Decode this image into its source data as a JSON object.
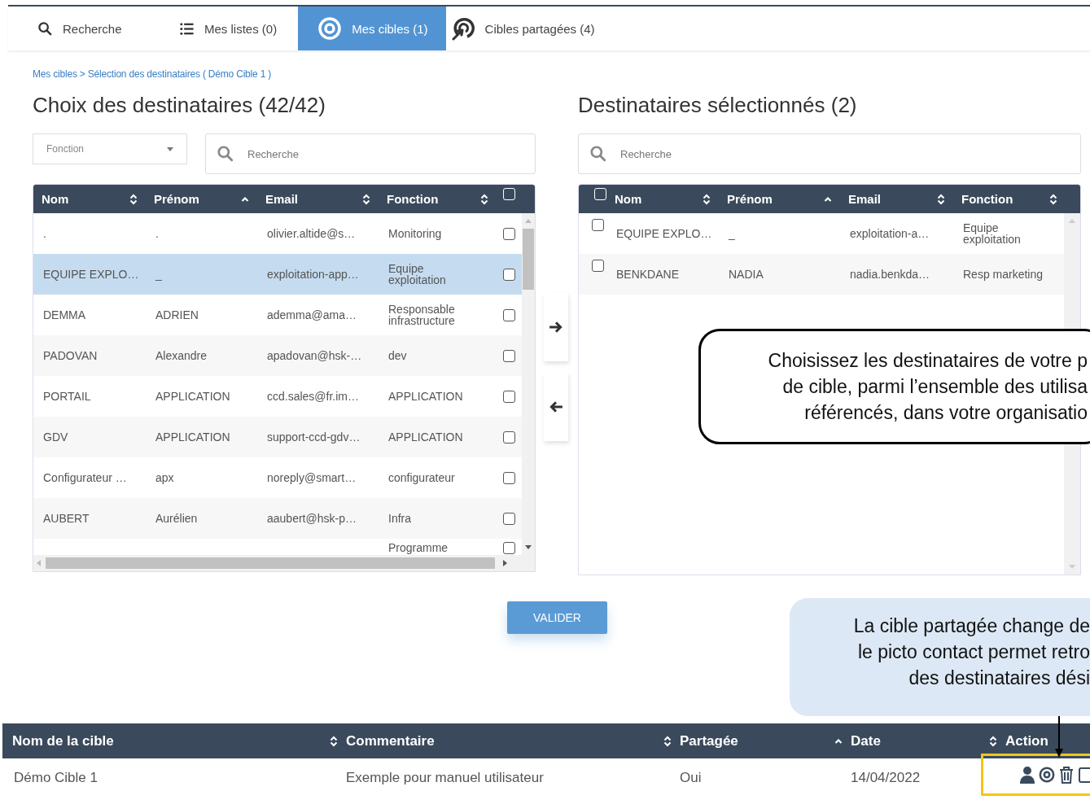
{
  "nav_tabs": [
    {
      "label": "Recherche",
      "selected": false
    },
    {
      "label": "Mes listes (0)",
      "selected": false
    },
    {
      "label": "Mes cibles (1)",
      "selected": true
    },
    {
      "label": "Cibles partagées (4)",
      "selected": false
    }
  ],
  "breadcrumb": "Mes cibles > Sélection des destinataires ( Démo Cible 1 )",
  "available": {
    "title": "Choix des destinataires (42/42)",
    "filter": {
      "placeholder": "Fonction"
    },
    "search": {
      "placeholder": "Recherche"
    },
    "columns": [
      {
        "label": "Nom",
        "kind": "sortable"
      },
      {
        "label": "Prénom",
        "kind": "sorted"
      },
      {
        "label": "Email",
        "kind": "sortable"
      },
      {
        "label": "Fonction",
        "kind": "sortable"
      }
    ],
    "select_all": {
      "checked": false
    },
    "rows": [
      {
        "nom": ".",
        "prenom": ".",
        "email": "olivier.altide@s…",
        "fonction": "Monitoring",
        "selected": false,
        "checked": false
      },
      {
        "nom": "EQUIPE EXPLO…",
        "prenom": "_",
        "email": "exploitation-app…",
        "fonction": "Equipe exploitation",
        "selected": true,
        "checked": false
      },
      {
        "nom": "DEMMA",
        "prenom": "ADRIEN",
        "email": "ademma@ama…",
        "fonction": "Responsable infrastructure",
        "selected": false,
        "checked": false
      },
      {
        "nom": "PADOVAN",
        "prenom": "Alexandre",
        "email": "apadovan@hsk-…",
        "fonction": "dev",
        "selected": false,
        "checked": false
      },
      {
        "nom": "PORTAIL",
        "prenom": "APPLICATION",
        "email": "ccd.sales@fr.im…",
        "fonction": "APPLICATION",
        "selected": false,
        "checked": false
      },
      {
        "nom": "GDV",
        "prenom": "APPLICATION",
        "email": "support-ccd-gdv…",
        "fonction": "APPLICATION",
        "selected": false,
        "checked": false
      },
      {
        "nom": "Configurateur …",
        "prenom": "apx",
        "email": "noreply@smart…",
        "fonction": "configurateur",
        "selected": false,
        "checked": false
      },
      {
        "nom": "AUBERT",
        "prenom": "Aurélien",
        "email": "aaubert@hsk-p…",
        "fonction": "Infra",
        "selected": false,
        "checked": false
      },
      {
        "fonction": "Programme",
        "selected": false,
        "checked": false
      }
    ]
  },
  "chosen": {
    "title": "Destinataires sélectionnés (2)",
    "search": {
      "placeholder": "Recherche"
    },
    "select_all": {
      "checked": false
    },
    "columns": [
      {
        "label": "Nom",
        "kind": "sortable"
      },
      {
        "label": "Prénom",
        "kind": "sorted"
      },
      {
        "label": "Email",
        "kind": "sortable"
      },
      {
        "label": "Fonction",
        "kind": "sortable"
      }
    ],
    "rows": [
      {
        "nom": "EQUIPE EXPLO…",
        "prenom": "_",
        "email": "exploitation-a…",
        "fonction": "Equipe exploitation",
        "checked": false
      },
      {
        "nom": "BENKDANE",
        "prenom": "NADIA",
        "email": "nadia.benkda…",
        "fonction": "Resp marketing",
        "checked": false
      }
    ]
  },
  "validate_button": "VALIDER",
  "callouts": [
    {
      "kind": "outline",
      "text": "Choisissez les destinataires de votre p\nde cible, parmi l’ensemble des utilisa\nréférencés, dans votre organisatio"
    },
    {
      "kind": "bubble",
      "text": "La cible partagée change de\nle picto contact permet retro\ndes destinataires dési"
    }
  ],
  "targets_table": {
    "columns": [
      {
        "label": "Nom de la cible",
        "kind": "plain"
      },
      {
        "label": "Commentaire",
        "kind": "sortable"
      },
      {
        "label": "Partagée",
        "kind": "sortable"
      },
      {
        "label": "Date",
        "kind": "sorted"
      },
      {
        "label": "Action",
        "kind": "sortable"
      }
    ],
    "rows": [
      {
        "cells": [
          "Démo Cible 1",
          "Exemple pour manuel utilisateur",
          "Oui",
          "14/04/2022"
        ],
        "highlighted": true
      }
    ]
  }
}
